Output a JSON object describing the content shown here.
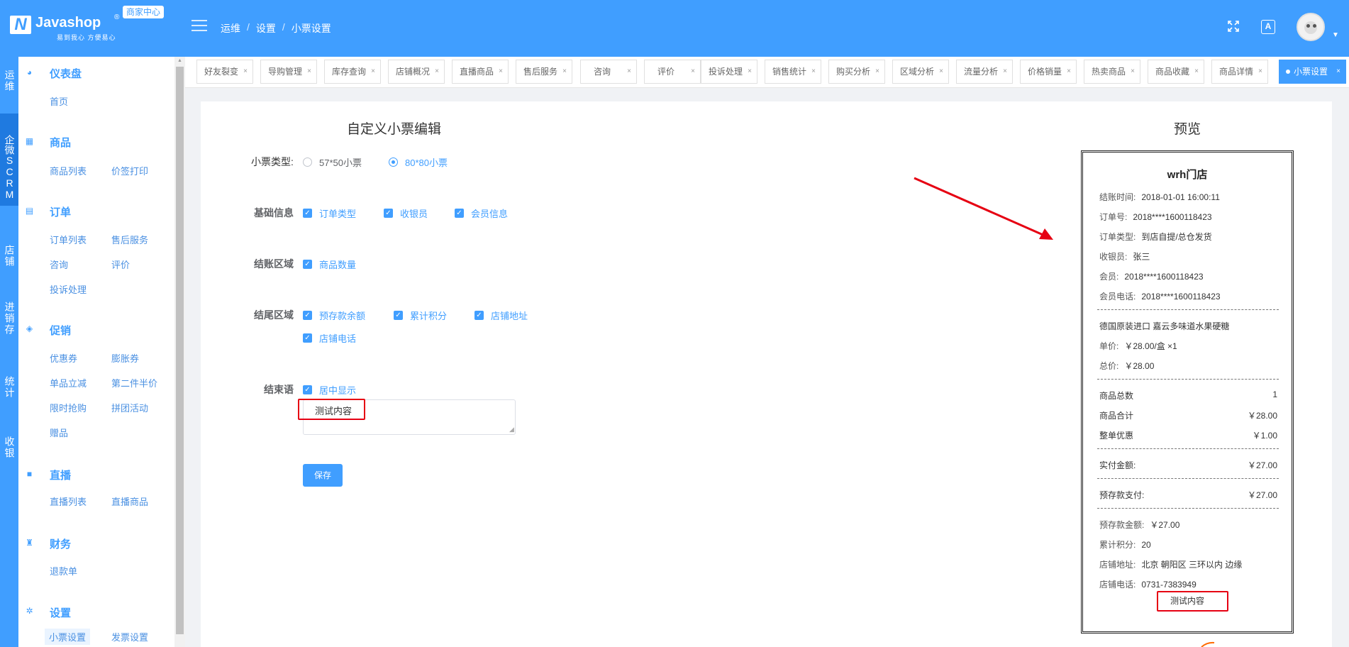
{
  "header": {
    "logo_letter": "N",
    "logo_name": "Javashop",
    "logo_reg": "®",
    "logo_slogan": "易到我心 方便易心",
    "merchant_tag": "商家中心",
    "breadcrumb": [
      "运维",
      "设置",
      "小票设置"
    ],
    "lang_label": "A"
  },
  "vnav": [
    {
      "label": "运维"
    },
    {
      "label": "企微SCRM"
    },
    {
      "label": "店铺"
    },
    {
      "label": "进销存"
    },
    {
      "label": "统计"
    },
    {
      "label": "收银"
    }
  ],
  "sidebar": {
    "groups": [
      {
        "title": "仪表盘",
        "icon": "dashboard-icon",
        "items": [
          "首页"
        ]
      },
      {
        "title": "商品",
        "icon": "grid-icon",
        "items": [
          "商品列表",
          "价签打印"
        ]
      },
      {
        "title": "订单",
        "icon": "clipboard-icon",
        "items": [
          "订单列表",
          "售后服务",
          "咨询",
          "评价",
          "投诉处理"
        ]
      },
      {
        "title": "促销",
        "icon": "tag-icon",
        "items": [
          "优惠券",
          "膨胀券",
          "单品立减",
          "第二件半价",
          "限时抢购",
          "拼团活动",
          "赠品"
        ]
      },
      {
        "title": "直播",
        "icon": "camera-icon",
        "items": [
          "直播列表",
          "直播商品"
        ]
      },
      {
        "title": "财务",
        "icon": "money-bag-icon",
        "items": [
          "退款单"
        ]
      },
      {
        "title": "设置",
        "icon": "gear-icon",
        "items": [
          "小票设置",
          "发票设置"
        ]
      }
    ]
  },
  "tabs": [
    "好友裂变",
    "导购管理",
    "库存查询",
    "店铺概况",
    "直播商品",
    "售后服务",
    "咨询",
    "评价",
    "投诉处理",
    "销售统计",
    "购买分析",
    "区域分析",
    "流量分析",
    "价格销量",
    "热卖商品",
    "商品收藏",
    "商品详情",
    "小票设置"
  ],
  "form": {
    "title": "自定义小票编辑",
    "ticket_type_label": "小票类型:",
    "ticket_type_options": [
      "57*50小票",
      "80*80小票"
    ],
    "basic_label": "基础信息",
    "basic_checks": [
      "订单类型",
      "收银员",
      "会员信息"
    ],
    "checkout_label": "结账区域",
    "checkout_checks": [
      "商品数量"
    ],
    "tail_label": "结尾区域",
    "tail_checks": [
      "预存款余额",
      "累计积分",
      "店铺地址",
      "店铺电话"
    ],
    "ending_label": "结束语",
    "ending_check": "居中显示",
    "ending_text": "测试内容",
    "save_label": "保存"
  },
  "preview": {
    "title": "预览",
    "shop_name": "wrh门店",
    "rows_top": [
      {
        "k": "结账时间:",
        "v": "2018-01-01 16:00:11"
      },
      {
        "k": "订单号:",
        "v": "2018****1600118423"
      },
      {
        "k": "订单类型:",
        "v": "到店自提/总仓发货"
      },
      {
        "k": "收银员:",
        "v": "张三"
      },
      {
        "k": "会员:",
        "v": "2018****1600118423"
      },
      {
        "k": "会员电话:",
        "v": "2018****1600118423"
      }
    ],
    "product_name": "德国原装进口 嘉云多味道水果硬糖",
    "unit_price_label": "单价:",
    "unit_price": "￥28.00/盒 ×1",
    "total_price_label": "总价:",
    "total_price": "￥28.00",
    "sum_rows": [
      {
        "k": "商品总数",
        "v": "1"
      },
      {
        "k": "商品合计",
        "v": "￥28.00"
      },
      {
        "k": "整单优惠",
        "v": "￥1.00"
      }
    ],
    "paid_label": "实付金额:",
    "paid_value": "￥27.00",
    "prepay_label": "预存款支付:",
    "prepay_value": "￥27.00",
    "rows_bottom": [
      {
        "k": "预存款金额:",
        "v": "￥27.00"
      },
      {
        "k": "累计积分:",
        "v": "20"
      },
      {
        "k": "店铺地址:",
        "v": "北京 朝阳区 三环以内 边缘"
      },
      {
        "k": "店铺电话:",
        "v": "0731-7383949"
      }
    ],
    "footer_text": "测试内容"
  },
  "colors": {
    "primary": "#409eff",
    "annotation_red": "#e60012"
  }
}
